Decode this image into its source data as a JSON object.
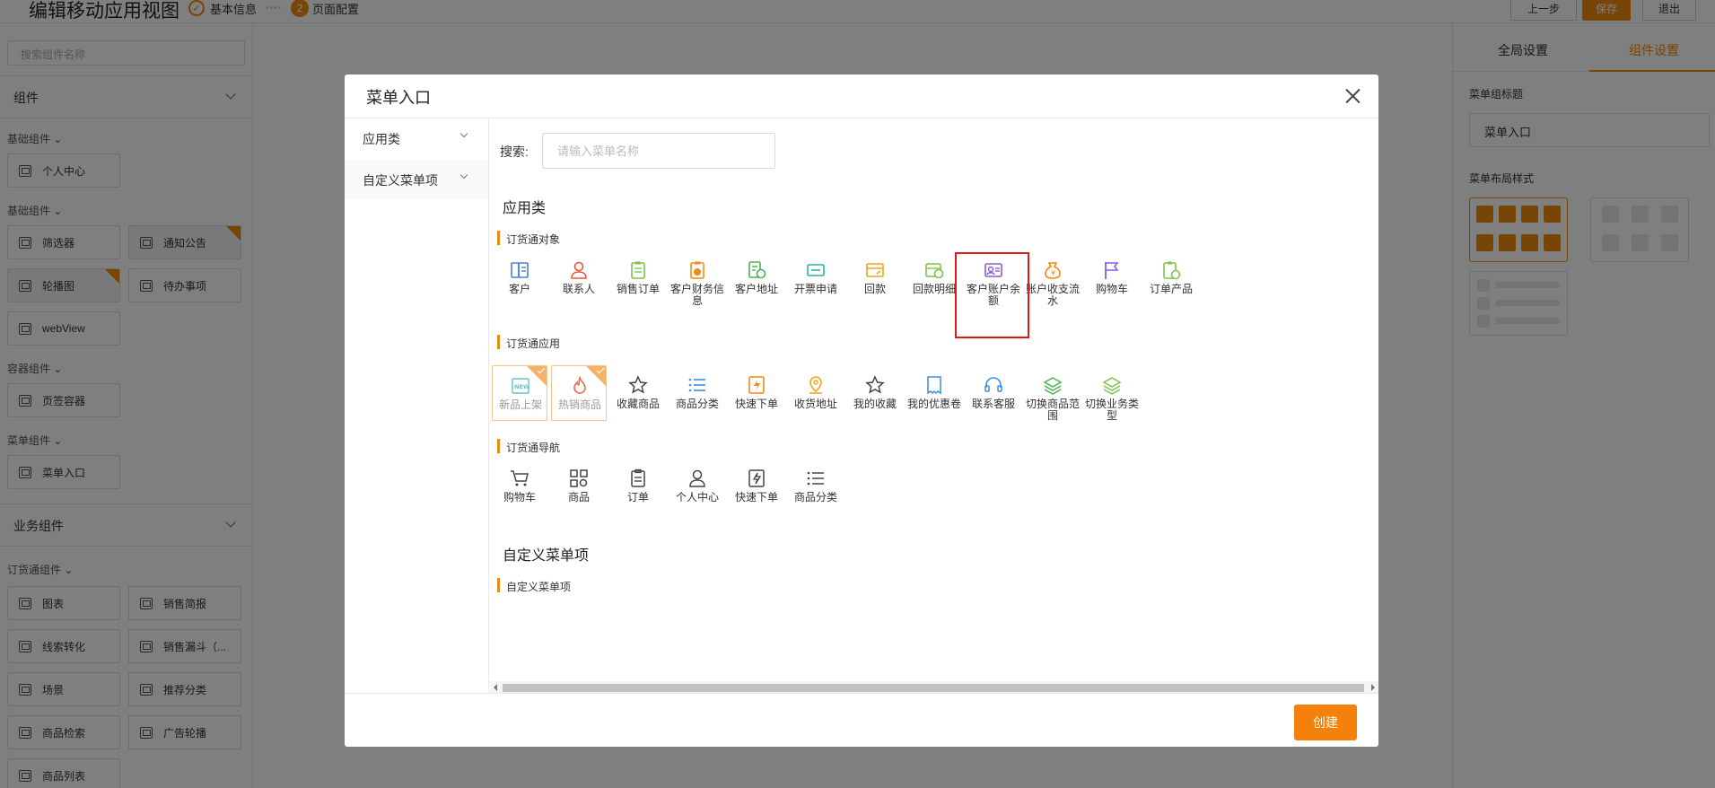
{
  "page": {
    "title": "编辑移动应用视图",
    "steps": [
      {
        "label": "基本信息",
        "dots": "••••"
      },
      {
        "num": "2",
        "label": "页面配置"
      }
    ],
    "buttons": {
      "prev": "上一步",
      "save": "保存",
      "exit": "退出"
    }
  },
  "left_panel": {
    "search_placeholder": "搜索组件名称",
    "section_components": "组件",
    "section_business": "业务组件",
    "groups": {
      "basic1": "基础组件",
      "basic2": "基础组件",
      "container": "容器组件",
      "menu": "菜单组件",
      "order": "订货通组件"
    },
    "components": {
      "personal_center": "个人中心",
      "filter": "筛选器",
      "notice": "通知公告",
      "carousel": "轮播图",
      "todo": "待办事项",
      "webview": "webView",
      "tab_container": "页签容器",
      "menu_entry": "菜单入口",
      "chart": "图表",
      "sales_brief": "销售简报",
      "lead_conversion": "线索转化",
      "sales_funnel": "销售漏斗（...",
      "scene": "场景",
      "recommend_category": "推荐分类",
      "product_search": "商品检索",
      "ad_carousel": "广告轮播",
      "product_list": "商品列表"
    }
  },
  "right_panel": {
    "tabs": [
      "全局设置",
      "组件设置"
    ],
    "active_tab": 1,
    "menu_title_label": "菜单组标题",
    "menu_title_value": "菜单入口",
    "layout_label": "菜单布局样式"
  },
  "modal": {
    "title": "菜单入口",
    "sidebar": [
      {
        "label": "应用类"
      },
      {
        "label": "自定义菜单项"
      }
    ],
    "search_label": "搜索:",
    "search_placeholder": "请输入菜单名称",
    "category_app": "应用类",
    "category_custom": "自定义菜单项",
    "sections": {
      "objects": {
        "title": "订货通对象",
        "items": [
          {
            "label": "客户",
            "icon": "customer-icon",
            "color": "#4a7ce0"
          },
          {
            "label": "联系人",
            "icon": "contact-icon",
            "color": "#e8553a"
          },
          {
            "label": "销售订单",
            "icon": "sales-order-icon",
            "color": "#7cc44a"
          },
          {
            "label": "客户财务信息",
            "icon": "finance-info-icon",
            "color": "#f08a0c"
          },
          {
            "label": "客户地址",
            "icon": "address-doc-icon",
            "color": "#4cb050"
          },
          {
            "label": "开票申请",
            "icon": "invoice-icon",
            "color": "#2bb3a0"
          },
          {
            "label": "回款",
            "icon": "payment-icon",
            "color": "#f2a31c"
          },
          {
            "label": "回款明细",
            "icon": "payment-detail-icon",
            "color": "#7cc44a"
          },
          {
            "label": "客户账户余额",
            "icon": "account-balance-icon",
            "color": "#8b5cd6"
          },
          {
            "label": "账户收支流水",
            "icon": "money-bag-icon",
            "color": "#f08a0c"
          },
          {
            "label": "购物车",
            "icon": "flag-icon",
            "color": "#8b5cd6"
          },
          {
            "label": "订单产品",
            "icon": "order-product-icon",
            "color": "#7cc44a"
          }
        ]
      },
      "apps": {
        "title": "订货通应用",
        "items": [
          {
            "label": "新品上架",
            "icon": "new-badge-icon",
            "color": "#5ec4c9",
            "checked": true
          },
          {
            "label": "热销商品",
            "icon": "fire-icon",
            "color": "#f06b4a",
            "checked": true
          },
          {
            "label": "收藏商品",
            "icon": "star-icon",
            "color": "#444444"
          },
          {
            "label": "商品分类",
            "icon": "list-icon",
            "color": "#3a8fe0"
          },
          {
            "label": "快速下单",
            "icon": "quick-order-icon",
            "color": "#f08a0c"
          },
          {
            "label": "收货地址",
            "icon": "location-pin-icon",
            "color": "#f2a31c"
          },
          {
            "label": "我的收藏",
            "icon": "star-outline-icon",
            "color": "#444444"
          },
          {
            "label": "我的优惠卷",
            "icon": "coupon-icon",
            "color": "#3a8fe0"
          },
          {
            "label": "联系客服",
            "icon": "headset-icon",
            "color": "#3a8fe0"
          },
          {
            "label": "切换商品范围",
            "icon": "layers-icon",
            "color": "#4cb050"
          },
          {
            "label": "切换业务类型",
            "icon": "layers-alt-icon",
            "color": "#7cc44a"
          }
        ]
      },
      "nav": {
        "title": "订货通导航",
        "items": [
          {
            "label": "购物车",
            "icon": "cart-icon",
            "color": "#444444"
          },
          {
            "label": "商品",
            "icon": "grid-icon",
            "color": "#444444"
          },
          {
            "label": "订单",
            "icon": "clipboard-icon",
            "color": "#444444"
          },
          {
            "label": "个人中心",
            "icon": "user-icon",
            "color": "#444444"
          },
          {
            "label": "快速下单",
            "icon": "quick-order-outline-icon",
            "color": "#444444"
          },
          {
            "label": "商品分类",
            "icon": "list-outline-icon",
            "color": "#444444"
          }
        ]
      },
      "custom": {
        "title": "自定义菜单项"
      }
    },
    "create_button": "创建"
  },
  "colors": {
    "accent": "#f08a0c",
    "highlight": "#e01b1b"
  }
}
